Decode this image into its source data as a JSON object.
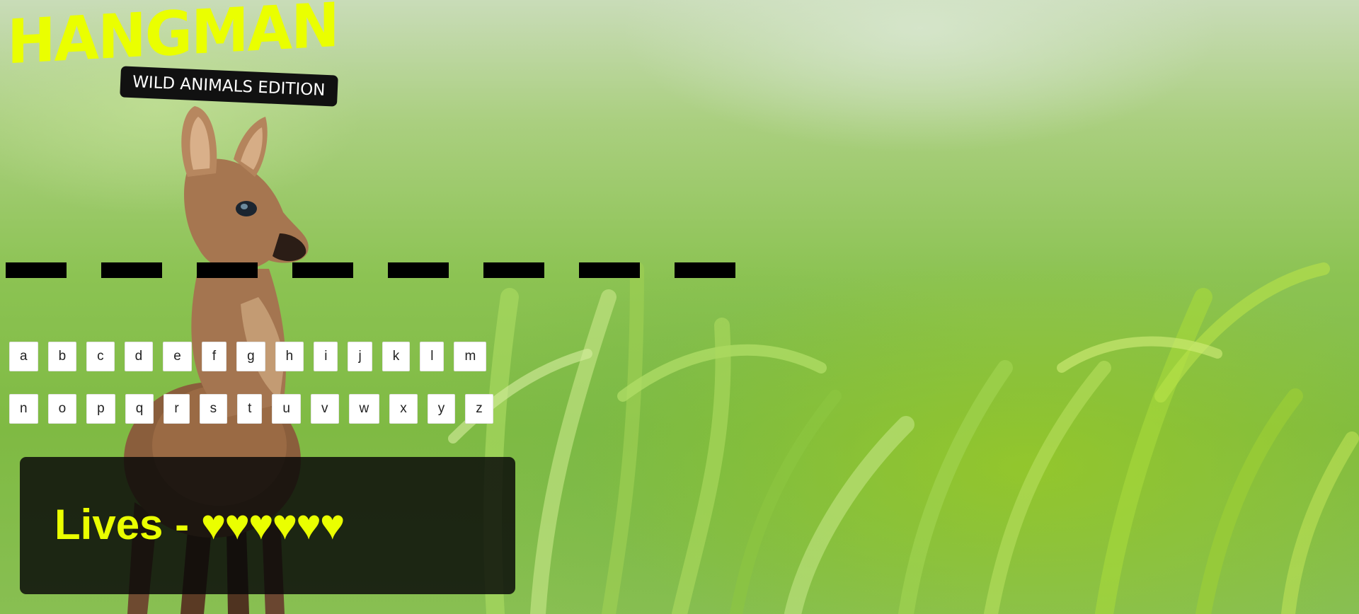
{
  "game": {
    "title": "HANGMAN",
    "subtitle": "WILD ANIMALS EDITION",
    "accent_color": "#eaff00"
  },
  "word": {
    "length": 8,
    "slots": [
      "",
      "",
      "",
      "",
      "",
      "",
      "",
      ""
    ]
  },
  "keyboard": {
    "rows": [
      [
        "a",
        "b",
        "c",
        "d",
        "e",
        "f",
        "g",
        "h",
        "i",
        "j",
        "k",
        "l",
        "m"
      ],
      [
        "n",
        "o",
        "p",
        "q",
        "r",
        "s",
        "t",
        "u",
        "v",
        "w",
        "x",
        "y",
        "z"
      ]
    ]
  },
  "lives": {
    "label": "Lives - ",
    "hearts": "♥♥♥♥♥♥",
    "count": 6,
    "icon": "heart-icon"
  }
}
